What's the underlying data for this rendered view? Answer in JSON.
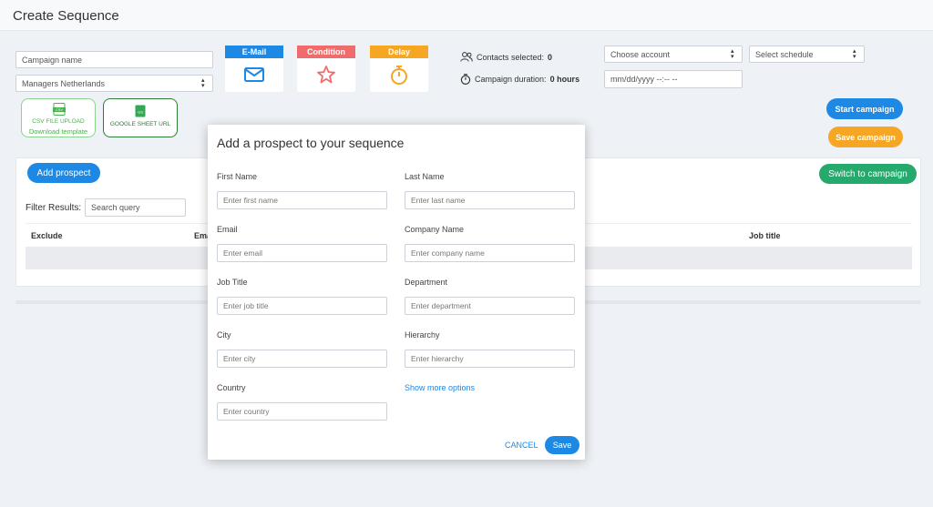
{
  "header": {
    "title": "Create Sequence"
  },
  "form": {
    "campaign_name_placeholder": "Campaign name",
    "list_select": "Managers Netherlands",
    "upload_csv_label": "CSV FILE UPLOAD",
    "upload_csv_sub": "Download template",
    "upload_csv_tag": "CSV",
    "upload_gs_label": "GOOGLE SHEET URL",
    "upload_gs_tag": "GS"
  },
  "steps": [
    {
      "label": "E-Mail",
      "color": "#1e88e5",
      "icon": "envelope-icon"
    },
    {
      "label": "Condition",
      "color": "#ef6c6c",
      "icon": "star-icon"
    },
    {
      "label": "Delay",
      "color": "#f5a623",
      "icon": "stopwatch-icon"
    }
  ],
  "stats": {
    "contacts_label": "Contacts selected:",
    "contacts_value": "0",
    "duration_label": "Campaign duration:",
    "duration_value": "0 hours"
  },
  "controls": {
    "account_select": "Choose account",
    "schedule_select": "Select schedule",
    "date_placeholder": "mm/dd/yyyy --:-- --",
    "start_campaign": "Start campaign",
    "save_campaign": "Save campaign"
  },
  "table": {
    "add_prospect": "Add prospect",
    "switch_to_campaign": "Switch to campaign",
    "filter_label": "Filter Results:",
    "search_placeholder": "Search query",
    "columns": [
      "Exclude",
      "Ema",
      "Job title"
    ]
  },
  "modal": {
    "title": "Add a prospect to your sequence",
    "fields": [
      {
        "label": "First Name",
        "placeholder": "Enter first name"
      },
      {
        "label": "Last Name",
        "placeholder": "Enter last name"
      },
      {
        "label": "Email",
        "placeholder": "Enter email"
      },
      {
        "label": "Company Name",
        "placeholder": "Enter company name"
      },
      {
        "label": "Job Title",
        "placeholder": "Enter job title"
      },
      {
        "label": "Department",
        "placeholder": "Enter department"
      },
      {
        "label": "City",
        "placeholder": "Enter city"
      },
      {
        "label": "Hierarchy",
        "placeholder": "Enter hierarchy"
      },
      {
        "label": "Country",
        "placeholder": "Enter country"
      }
    ],
    "show_more": "Show more options",
    "cancel": "CANCEL",
    "save": "Save"
  },
  "colors": {
    "primary": "#1e88e5",
    "orange": "#f5a623",
    "green": "#26a96c"
  }
}
